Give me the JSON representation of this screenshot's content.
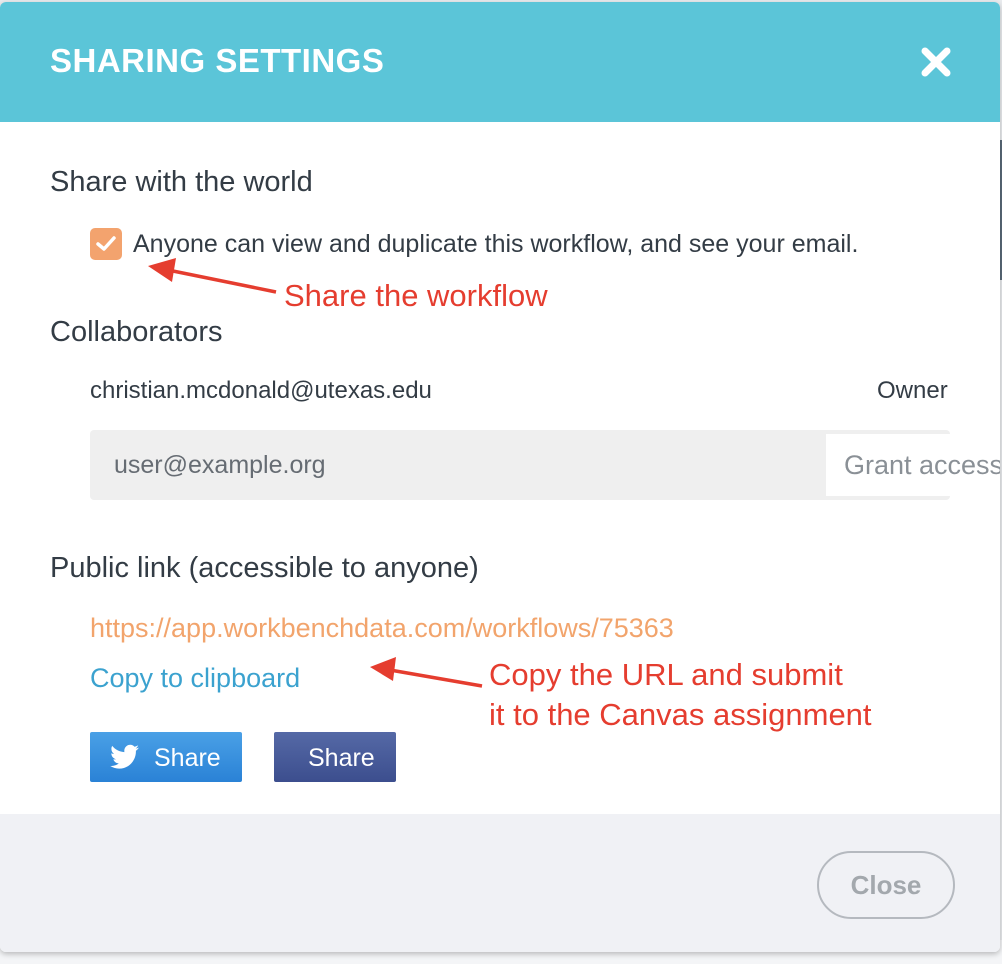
{
  "modal": {
    "title": "SHARING SETTINGS",
    "header_color": "#5bc5d8"
  },
  "world": {
    "title": "Share with the world",
    "checkbox_checked": true,
    "checkbox_label": "Anyone can view and duplicate this workflow, and see your email."
  },
  "collaborators": {
    "title": "Collaborators",
    "items": [
      {
        "email": "christian.mcdonald@utexas.edu",
        "role": "Owner"
      }
    ],
    "input_placeholder": "user@example.org",
    "grant_button": "Grant access"
  },
  "public_link": {
    "title": "Public link (accessible to anyone)",
    "url": "https://app.workbenchdata.com/workflows/75363",
    "copy_label": "Copy to clipboard"
  },
  "share_buttons": {
    "twitter_label": "Share",
    "facebook_label": "Share",
    "twitter_icon": "twitter-bird-icon"
  },
  "footer": {
    "close_label": "Close"
  },
  "annotations": {
    "share_workflow": "Share the workflow",
    "copy_url_line1": "Copy the URL and submit",
    "copy_url_line2": "it to the Canvas assignment",
    "color": "#e53d2f"
  }
}
